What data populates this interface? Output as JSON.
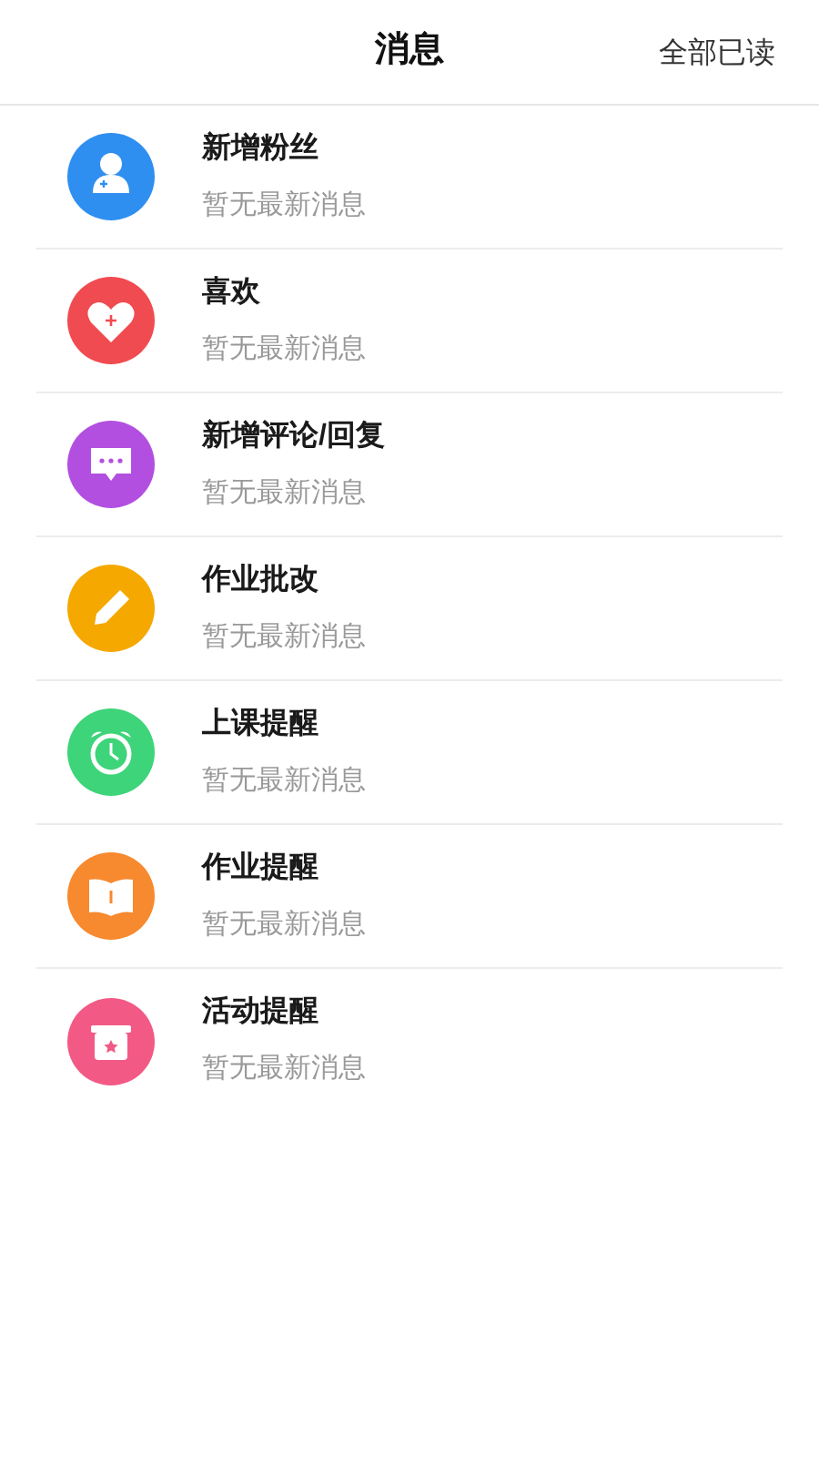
{
  "header": {
    "title": "消息",
    "action": "全部已读"
  },
  "items": [
    {
      "kind": "person",
      "color": "#2f8ff0",
      "title": "新增粉丝",
      "subtitle": "暂无最新消息"
    },
    {
      "kind": "heart",
      "color": "#f04b50",
      "title": "喜欢",
      "subtitle": "暂无最新消息"
    },
    {
      "kind": "chat",
      "color": "#b24fe0",
      "title": "新增评论/回复",
      "subtitle": "暂无最新消息"
    },
    {
      "kind": "pencil",
      "color": "#f5a800",
      "title": "作业批改",
      "subtitle": "暂无最新消息"
    },
    {
      "kind": "alarm",
      "color": "#3ed47a",
      "title": "上课提醒",
      "subtitle": "暂无最新消息"
    },
    {
      "kind": "book",
      "color": "#f7892e",
      "title": "作业提醒",
      "subtitle": "暂无最新消息"
    },
    {
      "kind": "gift",
      "color": "#f25a85",
      "title": "活动提醒",
      "subtitle": "暂无最新消息"
    }
  ]
}
